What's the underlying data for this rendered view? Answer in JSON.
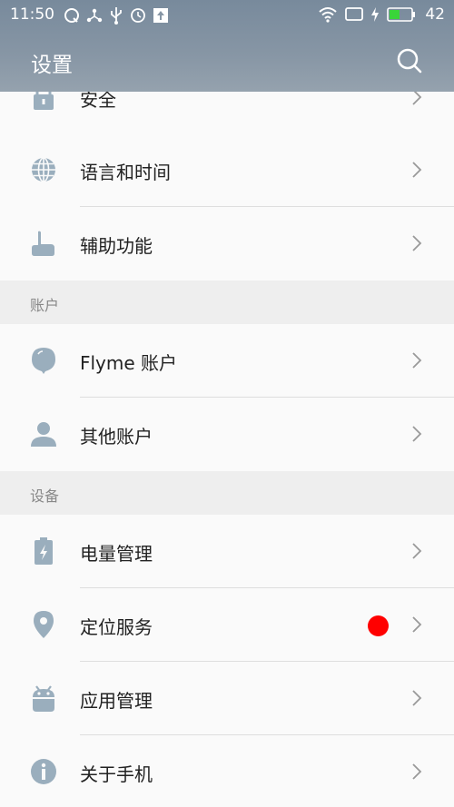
{
  "status_bar": {
    "time": "11:50",
    "battery": "42",
    "left_icons": [
      "notification-icon",
      "share-icon",
      "usb-icon",
      "clock-icon",
      "upload-icon"
    ],
    "right_icons": [
      "wifi-icon",
      "screen-icon",
      "charging-icon",
      "battery-icon"
    ]
  },
  "header": {
    "title": "设置",
    "search_icon": "search-icon"
  },
  "rows_top": [
    {
      "label": "安全",
      "icon": "lock-icon"
    },
    {
      "label": "语言和时间",
      "icon": "globe-icon"
    },
    {
      "label": "辅助功能",
      "icon": "hand-icon"
    }
  ],
  "sections": [
    {
      "label": "账户",
      "items": [
        {
          "label": "Flyme 账户",
          "icon": "flyme-icon"
        },
        {
          "label": "其他账户",
          "icon": "person-icon"
        }
      ]
    },
    {
      "label": "设备",
      "items": [
        {
          "label": "电量管理",
          "icon": "battery-manage-icon"
        },
        {
          "label": "定位服务",
          "icon": "location-icon",
          "badge_color": "#ff0000"
        },
        {
          "label": "应用管理",
          "icon": "android-icon"
        },
        {
          "label": "关于手机",
          "icon": "info-icon"
        }
      ]
    }
  ],
  "colors": {
    "icon": "#9aaebd",
    "header": "#8796a5",
    "badge": "#ff0000"
  }
}
